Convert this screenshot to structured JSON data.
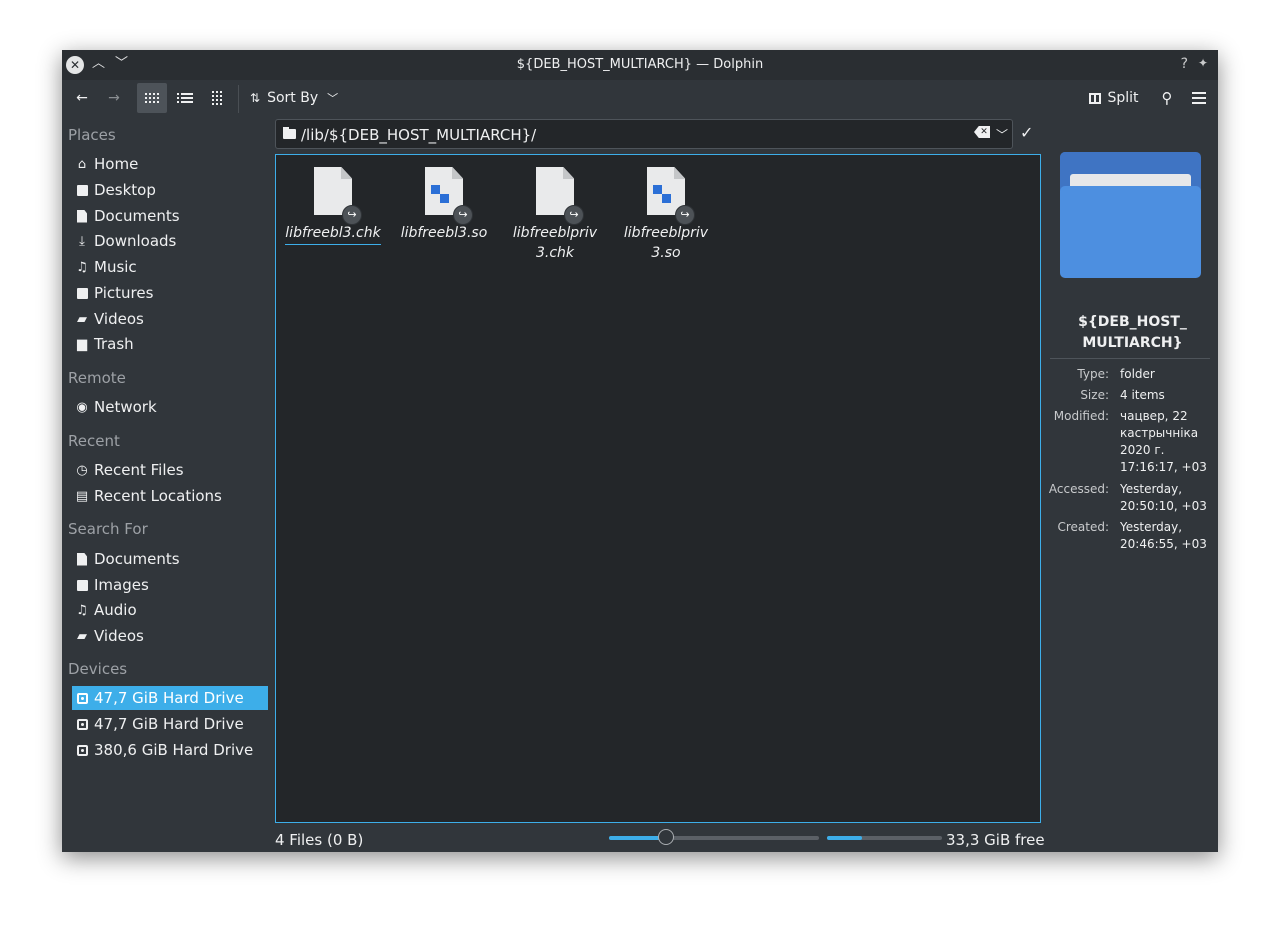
{
  "window": {
    "title": "${DEB_HOST_MULTIARCH} — Dolphin",
    "help_glyph": "?",
    "pin_glyph": "✦"
  },
  "toolbar": {
    "sort_label": "Sort By",
    "split_label": "Split",
    "back_glyph": "←",
    "forward_glyph": "→"
  },
  "sidebar": {
    "sections": [
      {
        "title": "Places",
        "items": [
          {
            "label": "Home",
            "icon": "home-icon"
          },
          {
            "label": "Desktop",
            "icon": "desktop-icon"
          },
          {
            "label": "Documents",
            "icon": "document-icon"
          },
          {
            "label": "Downloads",
            "icon": "download-icon"
          },
          {
            "label": "Music",
            "icon": "music-icon"
          },
          {
            "label": "Pictures",
            "icon": "picture-icon"
          },
          {
            "label": "Videos",
            "icon": "video-icon"
          },
          {
            "label": "Trash",
            "icon": "trash-icon"
          }
        ]
      },
      {
        "title": "Remote",
        "items": [
          {
            "label": "Network",
            "icon": "network-icon"
          }
        ]
      },
      {
        "title": "Recent",
        "items": [
          {
            "label": "Recent Files",
            "icon": "clock-icon"
          },
          {
            "label": "Recent Locations",
            "icon": "recent-locations-icon"
          }
        ]
      },
      {
        "title": "Search For",
        "items": [
          {
            "label": "Documents",
            "icon": "document-icon"
          },
          {
            "label": "Images",
            "icon": "picture-icon"
          },
          {
            "label": "Audio",
            "icon": "music-icon"
          },
          {
            "label": "Videos",
            "icon": "video-icon"
          }
        ]
      },
      {
        "title": "Devices",
        "items": [
          {
            "label": "47,7 GiB Hard Drive",
            "icon": "hard-drive-icon",
            "selected": true
          },
          {
            "label": "47,7 GiB Hard Drive",
            "icon": "hard-drive-icon"
          },
          {
            "label": "380,6 GiB Hard Drive",
            "icon": "hard-drive-icon"
          }
        ]
      }
    ]
  },
  "location": {
    "path": "/lib/${DEB_HOST_MULTIARCH}/"
  },
  "files": [
    {
      "name": "libfreebl3.chk",
      "kind": "text",
      "current": true
    },
    {
      "name": "libfreebl3.so",
      "kind": "library"
    },
    {
      "name": "libfreeblpriv3.chk",
      "kind": "text"
    },
    {
      "name": "libfreeblpriv3.so",
      "kind": "library"
    }
  ],
  "info": {
    "name_line1": "${DEB_HOST_",
    "name_line2": "MULTIARCH}",
    "meta": [
      {
        "key": "Type:",
        "lines": [
          "folder"
        ]
      },
      {
        "key": "Size:",
        "lines": [
          "4 items"
        ]
      },
      {
        "key": "Modified:",
        "lines": [
          "чацвер, 22",
          "кастрычніка",
          "2020 г.",
          "17:16:17, +03"
        ]
      },
      {
        "key": "Accessed:",
        "lines": [
          "Yesterday,",
          "20:50:10, +03"
        ]
      },
      {
        "key": "Created:",
        "lines": [
          "Yesterday,",
          "20:46:55, +03"
        ]
      }
    ]
  },
  "status": {
    "summary": "4 Files (0 B)",
    "zoom_fraction": 0.27,
    "space_used_fraction": 0.3,
    "free_space": "33,3 GiB free"
  },
  "colors": {
    "accent": "#3daee9",
    "window_bg": "#31363b",
    "view_bg": "#232629"
  }
}
